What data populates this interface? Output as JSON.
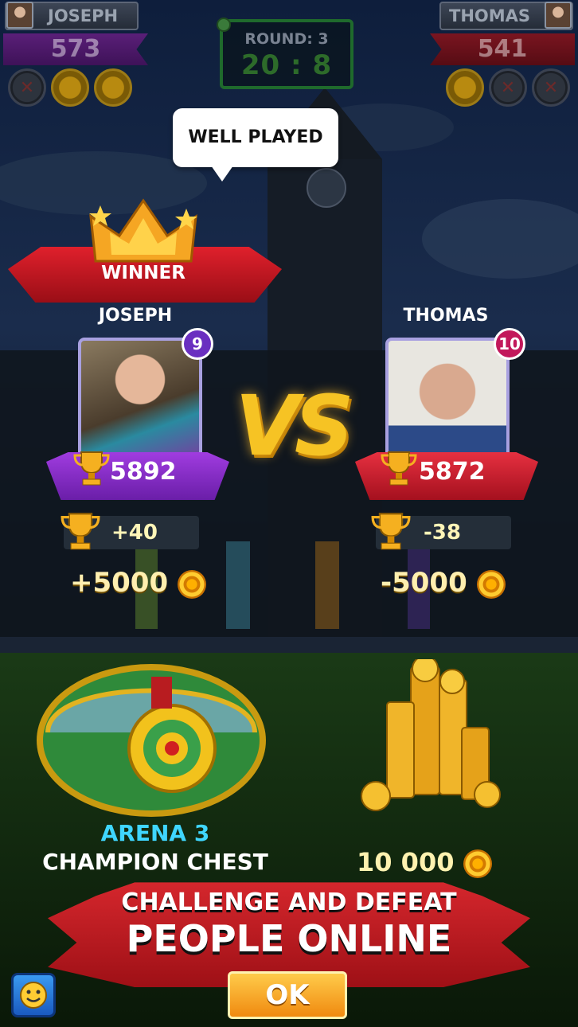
{
  "hud": {
    "left_player": {
      "name": "JOSEPH",
      "score": "573",
      "tokens": [
        "lose",
        "win",
        "win"
      ]
    },
    "right_player": {
      "name": "THOMAS",
      "score": "541",
      "tokens": [
        "win",
        "lose",
        "lose"
      ]
    },
    "round_label": "ROUND: 3",
    "round_score": "20 : 8"
  },
  "bubble_text": "WELL PLAYED",
  "winner_label": "WINNER",
  "players": {
    "left": {
      "name": "JOSEPH",
      "level": "9",
      "trophies": "5892",
      "trophy_delta": "+40",
      "coin_delta": "+5000"
    },
    "right": {
      "name": "THOMAS",
      "level": "10",
      "trophies": "5872",
      "trophy_delta": "-38",
      "coin_delta": "-5000"
    }
  },
  "vs_text": "VS",
  "rewards": {
    "arena": "ARENA 3",
    "chest": "CHAMPION CHEST",
    "coins": "10 000"
  },
  "banner": {
    "line1": "CHALLENGE AND DEFEAT",
    "line2": "PEOPLE ONLINE"
  },
  "ok_label": "OK",
  "icons": {
    "emoji": "emoji-face-icon",
    "coin": "coin-icon",
    "trophy": "trophy-icon",
    "crown": "crown-icon",
    "chest": "chest-icon"
  },
  "colors": {
    "left_accent": "#7a2bd0",
    "right_accent": "#d81f30",
    "gold": "#f6c324",
    "arena_cyan": "#3fd6ff"
  }
}
